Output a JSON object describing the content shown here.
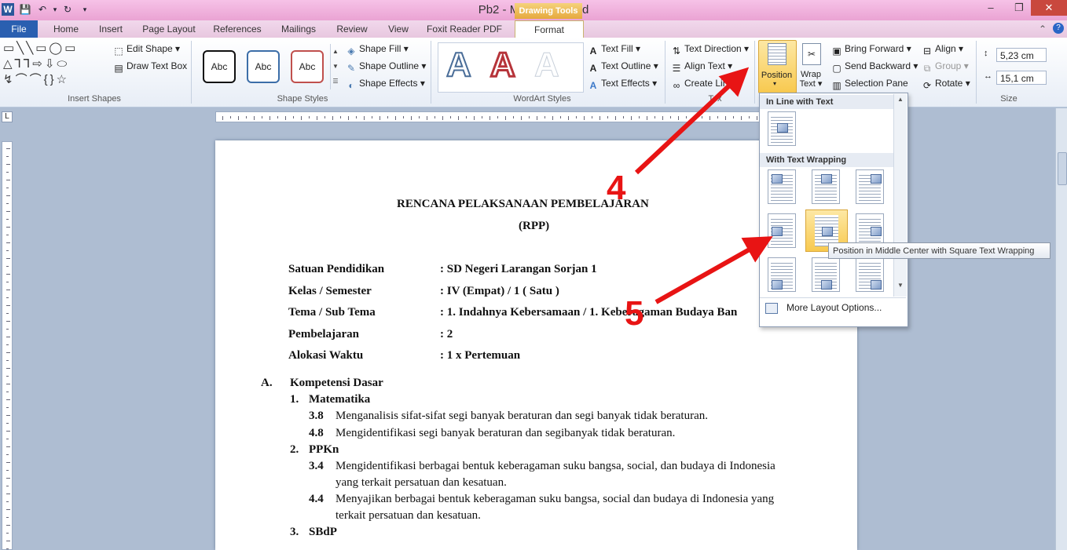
{
  "window": {
    "app_title": "Pb2 - Microsoft Word",
    "contextual_tab_group": "Drawing Tools",
    "controls": [
      "–",
      "❐",
      "✕"
    ]
  },
  "tabs": [
    "File",
    "Home",
    "Insert",
    "Page Layout",
    "References",
    "Mailings",
    "Review",
    "View",
    "Foxit Reader PDF",
    "Format"
  ],
  "ribbon": {
    "insert_shapes": {
      "edit_shape": "Edit Shape",
      "draw_text_box": "Draw Text Box",
      "label": "Insert Shapes"
    },
    "shape_styles": {
      "sample": "Abc",
      "shape_fill": "Shape Fill",
      "shape_outline": "Shape Outline",
      "shape_effects": "Shape Effects",
      "label": "Shape Styles"
    },
    "wordart_styles": {
      "sample": "A",
      "text_fill": "Text Fill",
      "text_outline": "Text Outline",
      "text_effects": "Text Effects",
      "label": "WordArt Styles"
    },
    "text": {
      "text_direction": "Text Direction",
      "align_text": "Align Text",
      "create_link": "Create Link",
      "label": "Tex"
    },
    "arrange": {
      "position": "Position",
      "wrap_text_1": "Wrap",
      "wrap_text_2": "Text",
      "bring_forward": "Bring Forward",
      "send_backward": "Send Backward",
      "selection_pane": "Selection Pane",
      "align": "Align",
      "group": "Group",
      "rotate": "Rotate"
    },
    "size": {
      "height": "5,23 cm",
      "width": "15,1 cm",
      "label": "Size"
    }
  },
  "position_menu": {
    "inline_header": "In Line with Text",
    "wrapping_header": "With Text Wrapping",
    "more_options": "More Layout Options...",
    "tooltip": "Position in Middle Center with Square Text Wrapping"
  },
  "annotations": {
    "step4": "4",
    "step5": "5",
    "arrow_color": "#e81414"
  },
  "document": {
    "title": "RENCANA PELAKSANAAN PEMBELAJARAN",
    "subtitle": "(RPP)",
    "info": [
      {
        "label": "Satuan Pendidikan",
        "value": ":  SD Negeri Larangan Sorjan 1"
      },
      {
        "label": "Kelas / Semester",
        "value": ":  IV (Empat) / 1 ( Satu )"
      },
      {
        "label": "Tema  / Sub Tema",
        "value": ":  1. Indahnya Kebersamaan / 1. Keberagaman Budaya Ban"
      },
      {
        "label": "Pembelajaran",
        "value": ":  2"
      },
      {
        "label": "Alokasi Waktu",
        "value": ":  1 x Pertemuan"
      }
    ],
    "section_a": {
      "letter": "A.",
      "title": "Kompetensi Dasar"
    },
    "subjects": [
      {
        "num": "1.",
        "name": "Matematika"
      },
      {
        "num": "2.",
        "name": "PPKn"
      },
      {
        "num": "3.",
        "name": "SBdP"
      }
    ],
    "items": [
      {
        "code": "3.8",
        "text": "Menganalisis  sifat-sifat segi banyak beraturan dan segi banyak tidak beraturan."
      },
      {
        "code": "4.8",
        "text": "Mengidentifikasi segi banyak beraturan dan segibanyak tidak beraturan."
      },
      {
        "code": "3.4",
        "text": "Mengidentifikasi berbagai bentuk keberagaman suku bangsa, social, dan budaya di Indonesia",
        "text2": "yang terkait persatuan dan kesatuan."
      },
      {
        "code": "4.4",
        "text": "Menyajikan berbagai bentuk keberagaman suku bangsa, social dan budaya di Indonesia yang",
        "text2": "terkait persatuan dan kesatuan."
      }
    ]
  }
}
